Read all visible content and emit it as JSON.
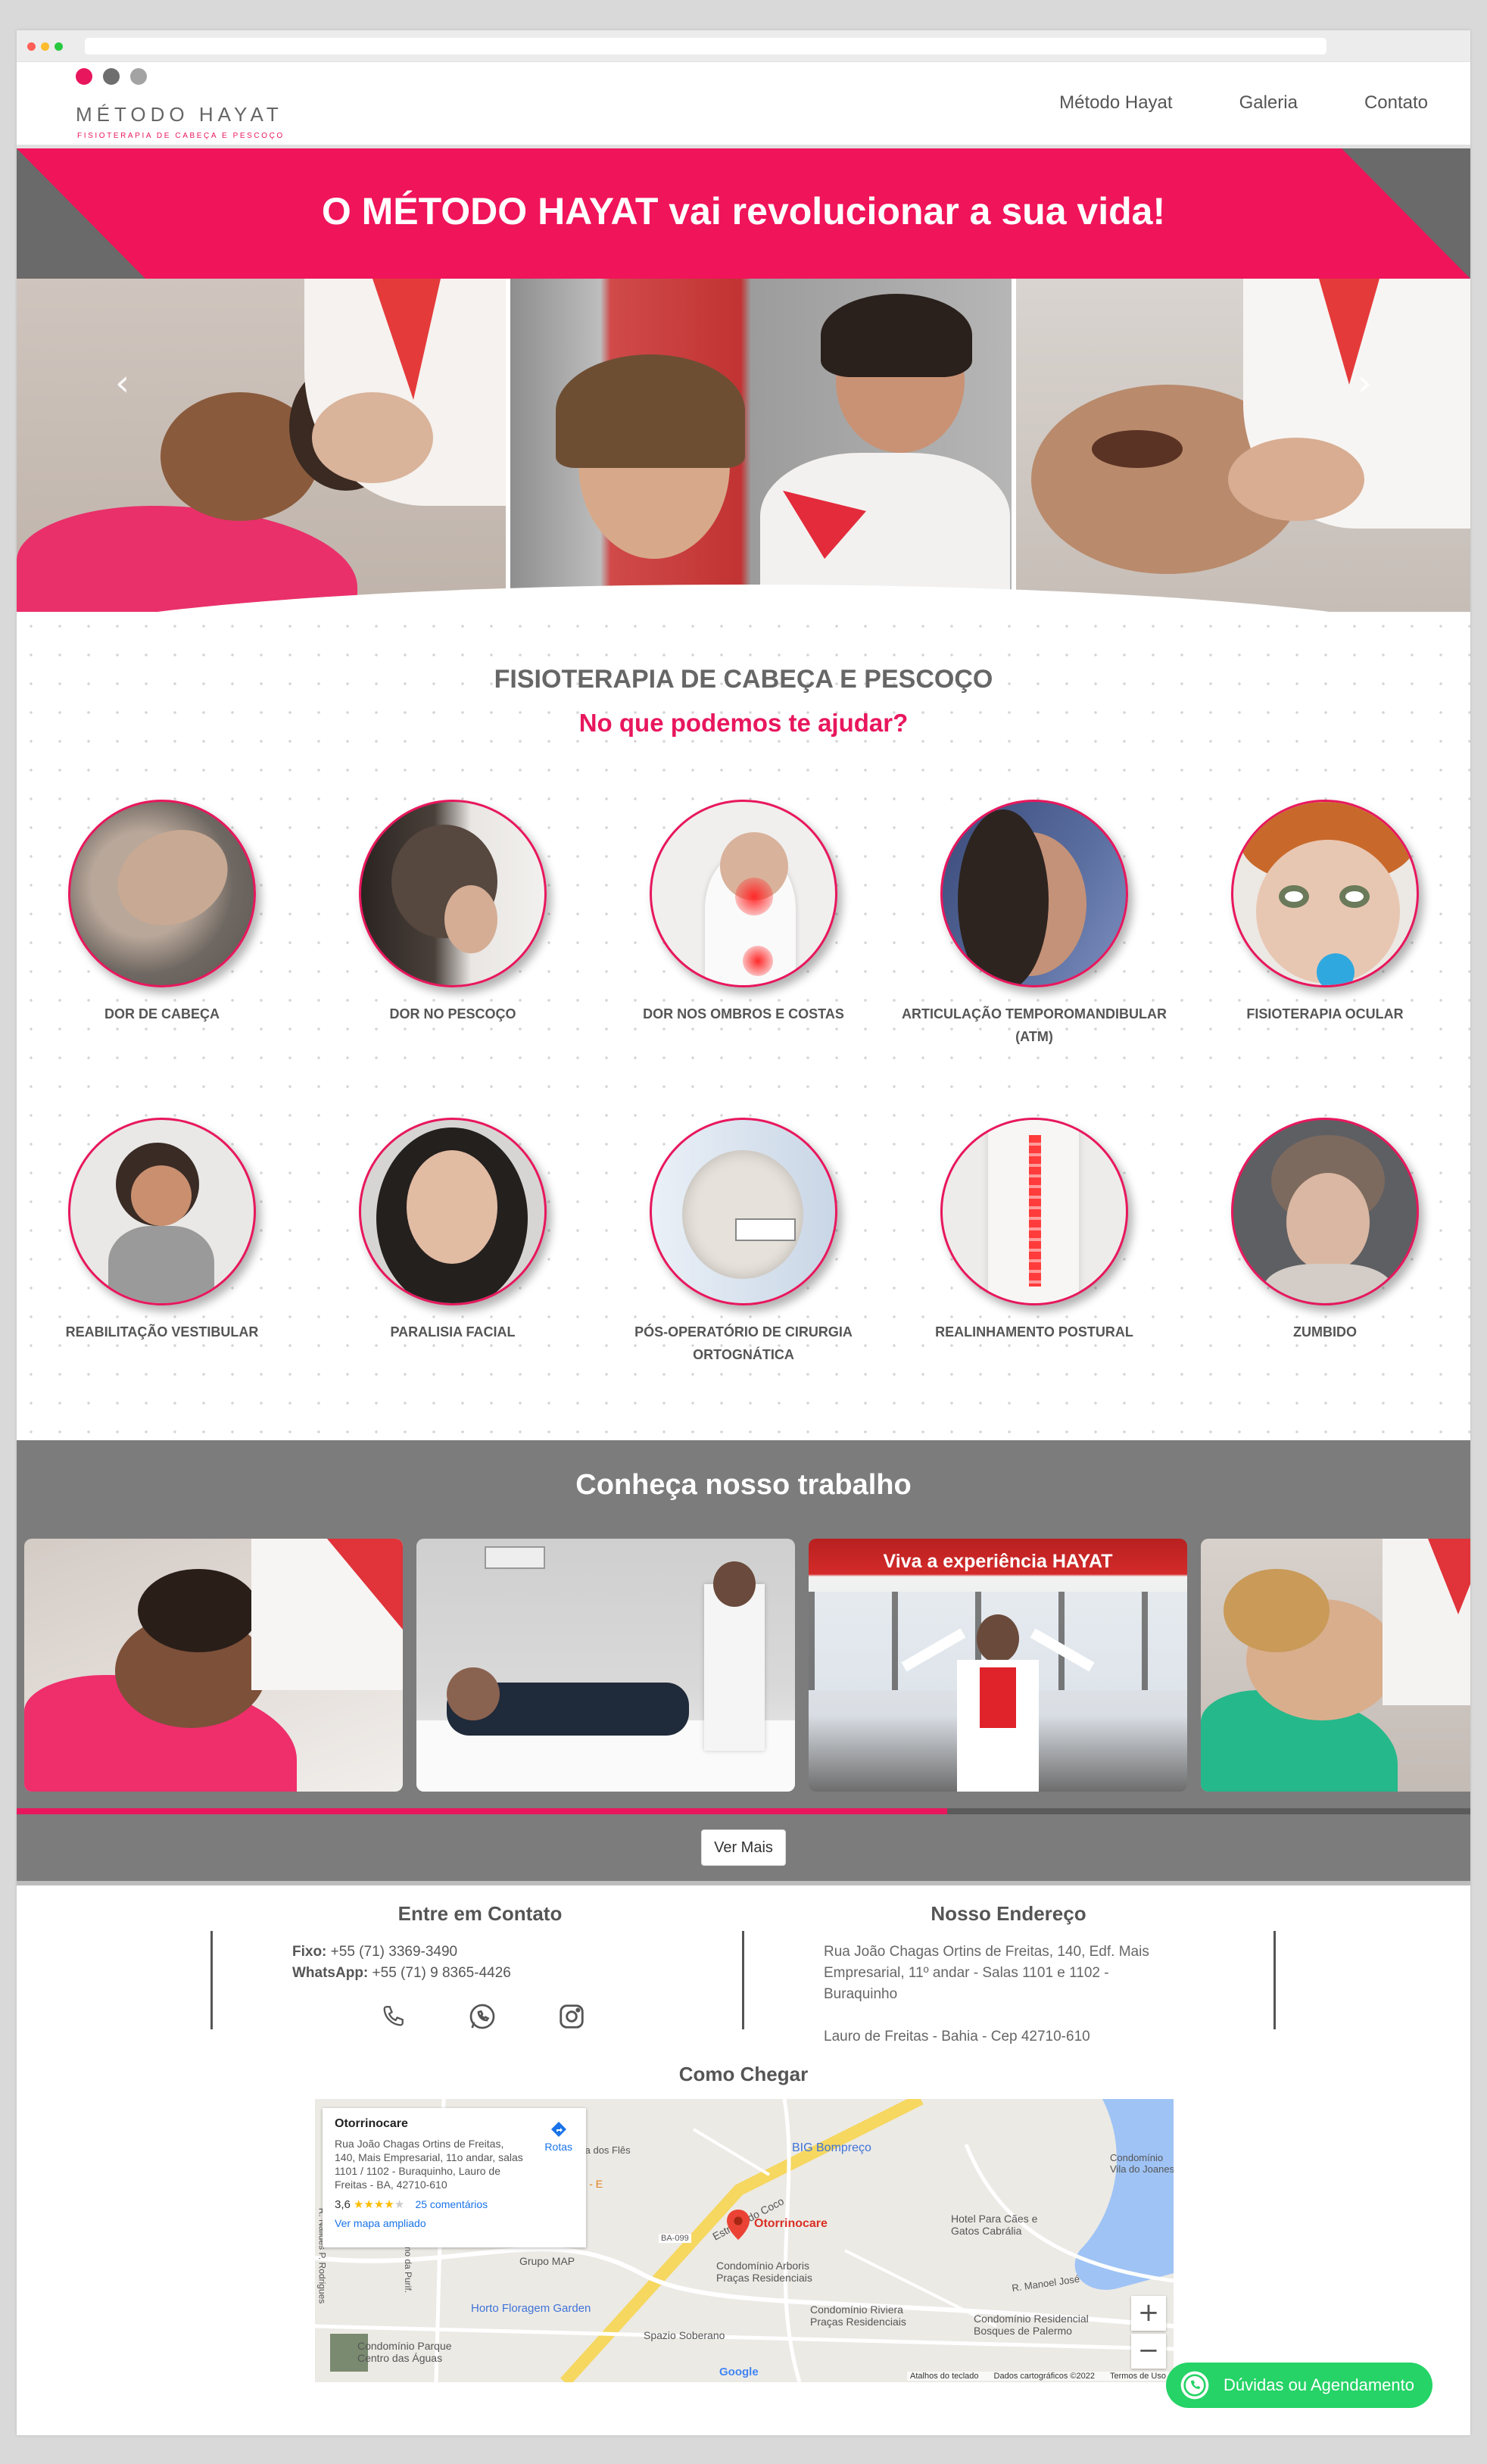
{
  "header": {
    "logo_title": "MÉTODO HAYAT",
    "logo_subtitle": "FISIOTERAPIA DE CABEÇA E PESCOÇO",
    "nav": [
      "Método Hayat",
      "Galeria",
      "Contato"
    ]
  },
  "banner": {
    "headline": "O MÉTODO HAYAT vai revolucionar a sua vida!"
  },
  "services": {
    "title": "FISIOTERAPIA DE CABEÇA E PESCOÇO",
    "subtitle": "No que podemos te ajudar?",
    "items": [
      "DOR DE CABEÇA",
      "DOR NO PESCOÇO",
      "DOR NOS OMBROS E COSTAS",
      "ARTICULAÇÃO TEMPOROMANDIBULAR (ATM)",
      "FISIOTERAPIA OCULAR",
      "REABILITAÇÃO VESTIBULAR",
      "PARALISIA FACIAL",
      "PÓS-OPERATÓRIO DE CIRURGIA ORTOGNÁTICA",
      "REALINHAMENTO POSTURAL",
      "ZUMBIDO"
    ]
  },
  "work": {
    "title": "Conheça nosso trabalho",
    "banner_text": "Viva a experiência HAYAT",
    "button": "Ver Mais",
    "progress": 0.64
  },
  "contact": {
    "title": "Entre em Contato",
    "fixo_label": "Fixo:",
    "fixo_value": "+55 (71) 3369-3490",
    "whatsapp_label": "WhatsApp:",
    "whatsapp_value": "+55 (71) 9 8365-4426"
  },
  "address": {
    "title": "Nosso Endereço",
    "line1": "Rua João Chagas Ortins de Freitas, 140, Edf. Mais",
    "line2": "Empresarial, 11º andar - Salas 1101 e 1102 -",
    "line3": "Buraquinho",
    "city": "Lauro de Freitas - Bahia - Cep 42710-610"
  },
  "map": {
    "title": "Como Chegar",
    "card_name": "Otorrinocare",
    "card_address": "Rua João Chagas Ortins de Freitas, 140, Mais Empresarial, 11o andar, salas 1101 / 1102 - Buraquinho, Lauro de Freitas - BA, 42710-610",
    "rating": "3,6",
    "reviews": "25 comentários",
    "routes": "Rotas",
    "enlarge": "Ver mapa ampliado",
    "pin_label": "Otorrinocare",
    "places": [
      "BIG Bompreço",
      "Estrada do Coco",
      "Grupo MAP",
      "Condomínio Arboris Praças Residenciais",
      "Horto Floragem Garden",
      "Condomínio Riviera Praças Residenciais",
      "Hotel Para Cães e Gatos Cabrália",
      "Condomínio Residencial Bosques de Palermo",
      "Spazio Soberano",
      "Condomínio Parque Centro das Águas",
      "CANHAS - E FREITAS",
      "Condomínio Vila do Joanes",
      "R. Manoel José",
      "R. Nalides P. Rodrigues",
      "R. Dalmo da Purif.",
      "Rua dos Flês",
      "BA-099"
    ],
    "footer": [
      "Atalhos do teclado",
      "Dados cartográficos ©2022",
      "Termos de Uso"
    ],
    "google": "Google"
  },
  "whatsapp_button": "Dúvidas ou Agendamento",
  "colors": {
    "accent": "#e8175d",
    "gray_banner": "#7c7c7c",
    "whatsapp": "#25d366"
  }
}
